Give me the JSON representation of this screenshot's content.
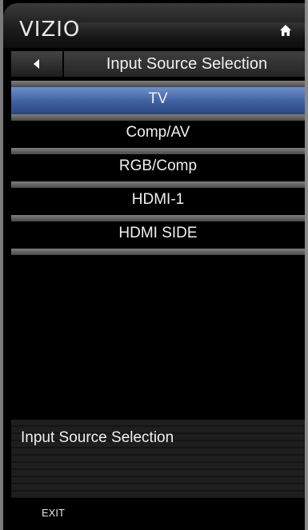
{
  "header": {
    "logo": "VIZIO",
    "home_icon": "home-icon"
  },
  "title_bar": {
    "back_icon": "triangle-left-icon",
    "title": "Input Source Selection"
  },
  "menu": {
    "items": [
      {
        "label": "TV",
        "selected": true
      },
      {
        "label": "Comp/AV",
        "selected": false
      },
      {
        "label": "RGB/Comp",
        "selected": false
      },
      {
        "label": "HDMI-1",
        "selected": false
      },
      {
        "label": "HDMI SIDE",
        "selected": false
      }
    ]
  },
  "info": {
    "text": "Input Source Selection"
  },
  "footer": {
    "exit_label": "EXIT"
  },
  "colors": {
    "selected": "#3e5f9e",
    "background": "#000000",
    "text": "#f0f0f0"
  }
}
